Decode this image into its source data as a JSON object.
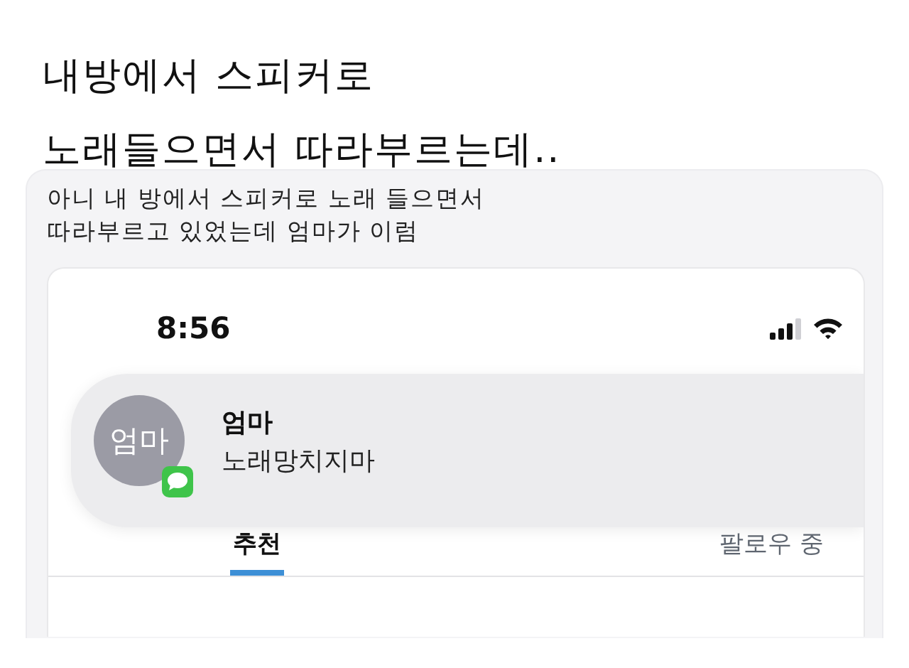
{
  "headline": {
    "lines": [
      "내방에서 스피커로",
      "노래들으면서 따라부르는데.."
    ]
  },
  "post": {
    "caption": [
      "아니 내 방에서 스피커로 노래 들으면서",
      "따라부르고 있었는데 엄마가 이럼"
    ],
    "screenshot": {
      "status_bar": {
        "time": "8:56"
      },
      "notification": {
        "avatar": "엄마",
        "sender": "엄마",
        "message": "노래망치지마"
      },
      "tabs": [
        {
          "label": "추천",
          "selected": true
        },
        {
          "label": "팔로우 중",
          "selected": false
        }
      ]
    }
  }
}
